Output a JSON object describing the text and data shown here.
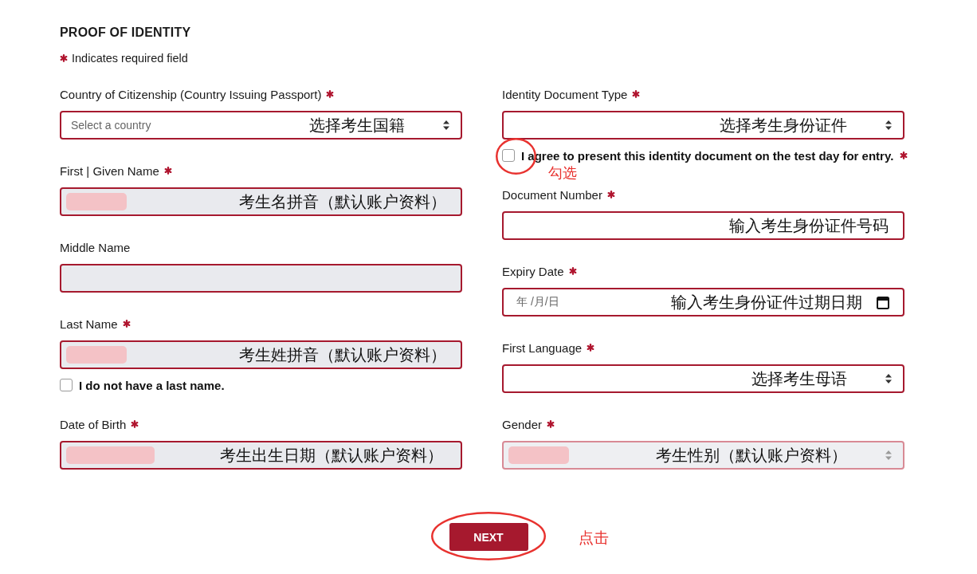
{
  "title": "PROOF OF IDENTITY",
  "required_legend": {
    "text": "Indicates required field"
  },
  "columns": [
    {
      "fields": [
        {
          "kind": "select",
          "label": "Country of Citizenship (Country Issuing Passport)",
          "required": true,
          "placeholder": "Select a country",
          "note": "选择考生国籍",
          "readonly": false,
          "disabled": false,
          "redacted": false
        },
        {
          "kind": "text",
          "label": "First | Given Name",
          "required": true,
          "note": "考生名拼音（默认账户资料）",
          "readonly": true,
          "disabled": false,
          "redacted": true
        },
        {
          "kind": "text",
          "label": "Middle Name",
          "required": false,
          "readonly": true,
          "disabled": false,
          "redacted": false
        },
        {
          "kind": "text",
          "label": "Last Name",
          "required": true,
          "note": "考生姓拼音（默认账户资料）",
          "readonly": true,
          "disabled": false,
          "redacted": true,
          "checkbox": {
            "label": "I do not have a last name.",
            "checked": false,
            "required": false
          }
        },
        {
          "kind": "date",
          "label": "Date of Birth",
          "required": true,
          "note": "考生出生日期（默认账户资料）",
          "readonly": true,
          "disabled": false,
          "redacted": true
        }
      ]
    },
    {
      "fields": [
        {
          "kind": "select",
          "label": "Identity Document Type",
          "required": true,
          "note": "选择考生身份证件",
          "readonly": false,
          "disabled": false,
          "redacted": false,
          "checkbox": {
            "label": "I agree to present this identity document on the test day for entry.",
            "checked": false,
            "required": true,
            "annotation": {
              "text": "勾选",
              "ring": true
            }
          }
        },
        {
          "kind": "text",
          "label": "Document Number",
          "required": true,
          "note": "输入考生身份证件号码",
          "readonly": false,
          "disabled": false,
          "redacted": false
        },
        {
          "kind": "date",
          "label": "Expiry Date",
          "required": true,
          "placeholder": "年 /月/日",
          "note": "输入考生身份证件过期日期",
          "readonly": false,
          "disabled": false,
          "redacted": false
        },
        {
          "kind": "select",
          "label": "First Language",
          "required": true,
          "note": "选择考生母语",
          "readonly": false,
          "disabled": false,
          "redacted": false
        },
        {
          "kind": "select",
          "label": "Gender",
          "required": true,
          "note": "考生性别（默认账户资料）",
          "readonly": true,
          "disabled": true,
          "redacted": true
        }
      ]
    }
  ],
  "next_button": {
    "label": "NEXT",
    "annotation": {
      "text": "点击",
      "ring": true
    }
  }
}
